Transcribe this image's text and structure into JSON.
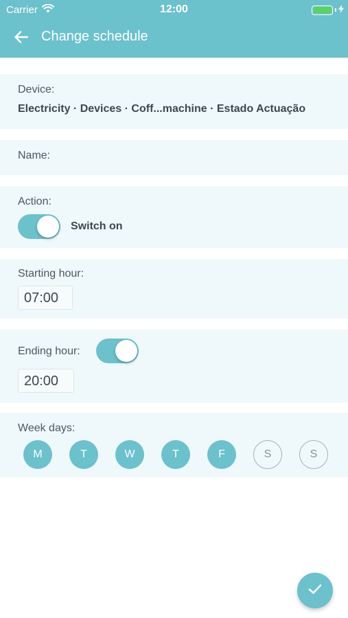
{
  "status_bar": {
    "carrier": "Carrier",
    "time": "12:00",
    "battery_level": 1.0,
    "battery_color": "#5cd35c"
  },
  "nav": {
    "title": "Change schedule",
    "back_icon": "arrow-left-icon"
  },
  "device": {
    "label": "Device:",
    "value": "Electricity · Devices · Coff...machine · Estado Actuação"
  },
  "name_field": {
    "label": "Name:",
    "value": ""
  },
  "action": {
    "label": "Action:",
    "toggle_on": true,
    "toggle_label": "Switch on"
  },
  "starting_hour": {
    "label": "Starting hour:",
    "value": "07:00"
  },
  "ending_hour": {
    "label": "Ending hour:",
    "toggle_on": true,
    "value": "20:00"
  },
  "week_days": {
    "label": "Week days:",
    "days": [
      {
        "letter": "M",
        "selected": true
      },
      {
        "letter": "T",
        "selected": true
      },
      {
        "letter": "W",
        "selected": true
      },
      {
        "letter": "T",
        "selected": true
      },
      {
        "letter": "F",
        "selected": true
      },
      {
        "letter": "S",
        "selected": false
      },
      {
        "letter": "S",
        "selected": false
      }
    ]
  },
  "confirm": {
    "icon": "check-icon"
  },
  "colors": {
    "accent": "#6bc1cc",
    "card_background": "#eff8fa"
  }
}
